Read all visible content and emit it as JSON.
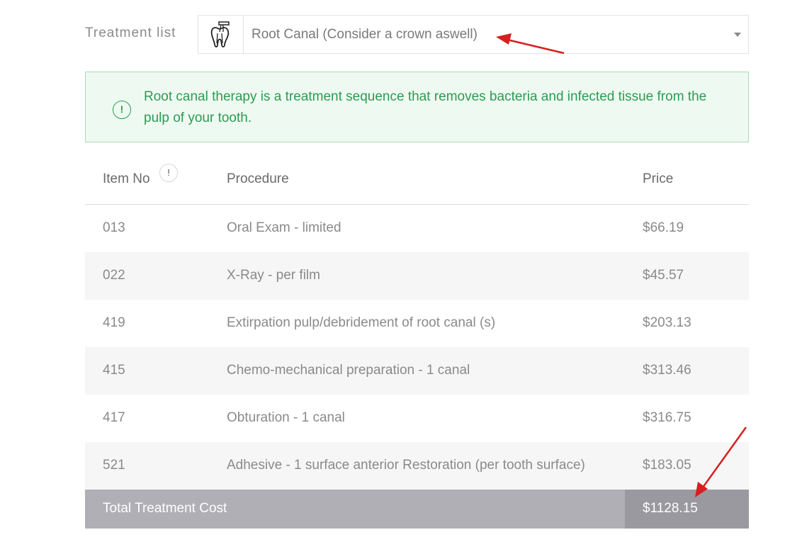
{
  "treatment": {
    "label": "Treatment list",
    "selected": "Root Canal (Consider a crown aswell)",
    "icon": "tooth-root-canal-icon"
  },
  "alert": {
    "icon": "info-icon",
    "icon_glyph": "!",
    "text": "Root canal therapy is a treatment sequence that removes bacteria and infected tissue from the pulp of your tooth."
  },
  "table": {
    "headers": {
      "item_no": "Item No",
      "info_glyph": "!",
      "procedure": "Procedure",
      "price": "Price"
    },
    "rows": [
      {
        "item": "013",
        "procedure": "Oral Exam - limited",
        "price": "$66.19"
      },
      {
        "item": "022",
        "procedure": "X-Ray - per film",
        "price": "$45.57"
      },
      {
        "item": "419",
        "procedure": "Extirpation pulp/debridement of root canal (s)",
        "price": "$203.13"
      },
      {
        "item": "415",
        "procedure": "Chemo-mechanical preparation - 1 canal",
        "price": "$313.46"
      },
      {
        "item": "417",
        "procedure": "Obturation - 1 canal",
        "price": "$316.75"
      },
      {
        "item": "521",
        "procedure": "Adhesive - 1 surface anterior Restoration (per tooth surface)",
        "price": "$183.05"
      }
    ]
  },
  "total": {
    "label": "Total Treatment Cost",
    "value": "$1128.15"
  },
  "colors": {
    "alert_text": "#2e9a53",
    "alert_bg": "#eefaf1",
    "total_bg": "#b0afb5",
    "total_price_bg": "#9a999f",
    "annotation_arrow": "#d61f1f"
  }
}
